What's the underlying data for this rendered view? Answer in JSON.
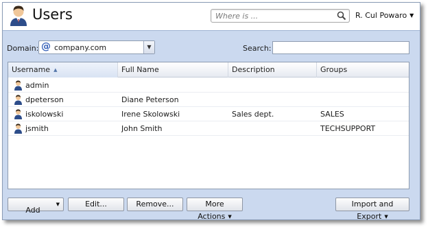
{
  "header": {
    "title": "Users",
    "search_placeholder": "Where is ...",
    "user_name": "R. Cul Powaro"
  },
  "filters": {
    "domain_label": "Domain:",
    "domain_value": "company.com",
    "search_label": "Search:",
    "search_value": ""
  },
  "table": {
    "columns": [
      "Username",
      "Full Name",
      "Description",
      "Groups"
    ],
    "sorted_column": "Username",
    "rows": [
      {
        "username": "admin",
        "full_name": "",
        "description": "",
        "groups": ""
      },
      {
        "username": "dpeterson",
        "full_name": "Diane Peterson",
        "description": "",
        "groups": ""
      },
      {
        "username": "iskolowski",
        "full_name": "Irene Skolowski",
        "description": "Sales dept.",
        "groups": "SALES"
      },
      {
        "username": "jsmith",
        "full_name": "John Smith",
        "description": "",
        "groups": "TECHSUPPORT"
      }
    ]
  },
  "buttons": {
    "add": "Add",
    "edit": "Edit...",
    "remove": "Remove...",
    "more_actions": "More Actions",
    "import_export": "Import and Export"
  },
  "icons": {
    "title_icon": "user-icon",
    "search": "search-icon",
    "domain": "at-sign-icon",
    "row": "user-icon"
  },
  "colors": {
    "panel_bg": "#cbd9ef",
    "accent": "#3560b8"
  }
}
